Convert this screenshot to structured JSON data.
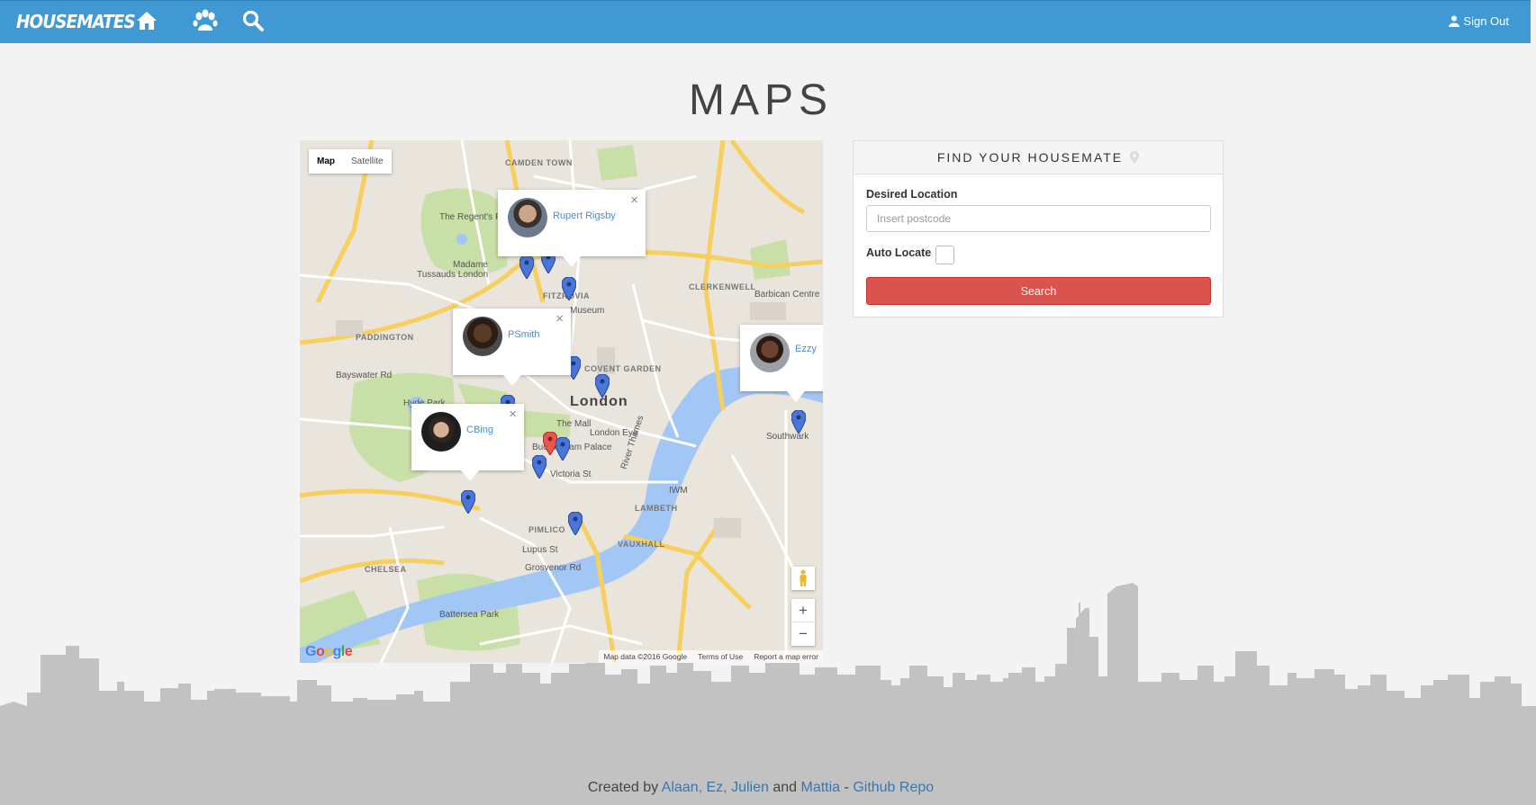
{
  "navbar": {
    "brand": "HOUSEMATES",
    "sign_out": "Sign Out",
    "icons": [
      "home-icon",
      "users-icon",
      "search-icon"
    ],
    "background": "#4199d3"
  },
  "page": {
    "title": "MAPS"
  },
  "map": {
    "type_control": {
      "map": "Map",
      "satellite": "Satellite"
    },
    "labels": {
      "camden_town": "CAMDEN TOWN",
      "regents_park": "The Regent's Park",
      "madame": "Madame",
      "tussauds": "Tussauds London",
      "fitzrovia": "FITZROVIA",
      "museum": "Museum",
      "clerkenwell": "CLERKENWELL",
      "barbican": "Barbican Centre",
      "paddington": "PADDINGTON",
      "bayswater": "Bayswater Rd",
      "covent_garden": "COVENT GARDEN",
      "london": "London",
      "london_eye": "London Eye",
      "the_mall": "The Mall",
      "buckingham": "Buckingham Palace",
      "victoria_st": "Victoria St",
      "iwm": "IWM",
      "lambeth": "LAMBETH",
      "southwark": "Southwark",
      "pimlico": "PIMLICO",
      "vauxhall": "VAUXHALL",
      "lupus_st": "Lupus St",
      "chelsea": "CHELSEA",
      "grosvenor": "Grosvenor Rd",
      "battersea": "Battersea Park",
      "river_thames": "River Thames",
      "hyde_park": "Hyde Park"
    },
    "info_windows": [
      {
        "name": "Rupert Rigsby"
      },
      {
        "name": "PSmith"
      },
      {
        "name": "CBing"
      },
      {
        "name": "Ezzy"
      }
    ],
    "zoom_in": "+",
    "zoom_out": "−",
    "google": "Google",
    "attribution": "Map data ©2016 Google",
    "terms": "Terms of Use",
    "report": "Report a map error",
    "marker_color": "#4a76d9",
    "selected_marker_color": "#e8564c"
  },
  "panel": {
    "heading": "FIND YOUR HOUSEMATE",
    "desired_location_label": "Desired Location",
    "postcode_placeholder": "Insert postcode",
    "auto_locate_label": "Auto Locate",
    "search_button": "Search",
    "button_color": "#d9534f"
  },
  "footer": {
    "created_by": "Created by",
    "authors": [
      "Alaan",
      "Ez",
      "Julien",
      "Mattia"
    ],
    "sep_comma": ",",
    "and": "and",
    "dash": "-",
    "repo": "Github Repo"
  }
}
